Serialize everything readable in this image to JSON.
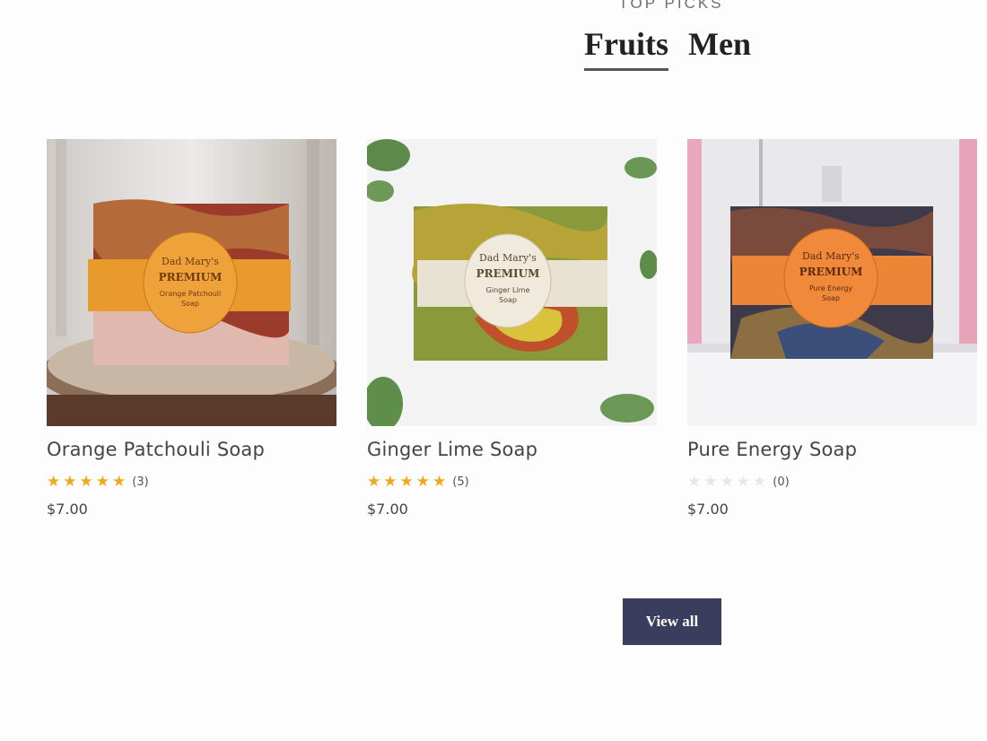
{
  "section": {
    "eyebrow": "TOP PICKS",
    "tabs": [
      {
        "label": "Fruits",
        "active": true
      },
      {
        "label": "Men",
        "active": false
      }
    ]
  },
  "products": [
    {
      "name": "Orange Patchouli Soap",
      "rating": 5,
      "review_count": "(3)",
      "price": "$7.00",
      "image_icon": "soap-bar-orange-label"
    },
    {
      "name": "Ginger Lime Soap",
      "rating": 5,
      "review_count": "(5)",
      "price": "$7.00",
      "image_icon": "soap-bar-cream-label"
    },
    {
      "name": "Pure Energy Soap",
      "rating": 0,
      "review_count": "(0)",
      "price": "$7.00",
      "image_icon": "soap-bar-orange-label"
    }
  ],
  "view_all": {
    "label": "View all"
  },
  "colors": {
    "accent": "#3b3d5e",
    "star": "#f2a71f",
    "star_empty": "#e7e7e7"
  }
}
